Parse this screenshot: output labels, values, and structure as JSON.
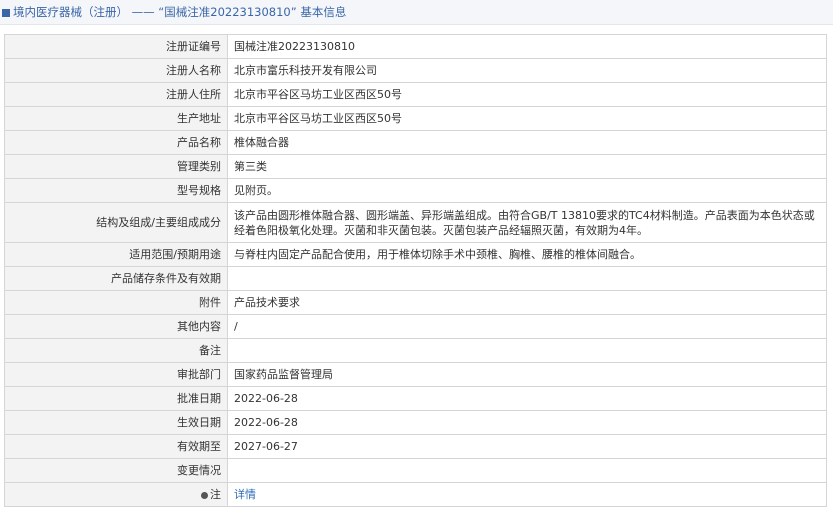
{
  "header": {
    "title": "境内医疗器械（注册） —— “国械注准20223130810” 基本信息"
  },
  "rows": [
    {
      "label": "注册证编号",
      "value": "国械注准20223130810"
    },
    {
      "label": "注册人名称",
      "value": "北京市富乐科技开发有限公司"
    },
    {
      "label": "注册人住所",
      "value": "北京市平谷区马坊工业区西区50号"
    },
    {
      "label": "生产地址",
      "value": "北京市平谷区马坊工业区西区50号"
    },
    {
      "label": "产品名称",
      "value": "椎体融合器"
    },
    {
      "label": "管理类别",
      "value": "第三类"
    },
    {
      "label": "型号规格",
      "value": "见附页。"
    },
    {
      "label": "结构及组成/主要组成成分",
      "value": "该产品由圆形椎体融合器、圆形端盖、异形端盖组成。由符合GB/T 13810要求的TC4材料制造。产品表面为本色状态或经着色阳极氧化处理。灭菌和非灭菌包装。灭菌包装产品经辐照灭菌，有效期为4年。"
    },
    {
      "label": "适用范围/预期用途",
      "value": "与脊柱内固定产品配合使用，用于椎体切除手术中颈椎、胸椎、腰椎的椎体间融合。"
    },
    {
      "label": "产品储存条件及有效期",
      "value": ""
    },
    {
      "label": "附件",
      "value": "产品技术要求"
    },
    {
      "label": "其他内容",
      "value": "/"
    },
    {
      "label": "备注",
      "value": ""
    },
    {
      "label": "审批部门",
      "value": "国家药品监督管理局"
    },
    {
      "label": "批准日期",
      "value": "2022-06-28"
    },
    {
      "label": "生效日期",
      "value": "2022-06-28"
    },
    {
      "label": "有效期至",
      "value": "2027-06-27"
    },
    {
      "label": "变更情况",
      "value": ""
    },
    {
      "label": "注",
      "value": "详情"
    }
  ]
}
